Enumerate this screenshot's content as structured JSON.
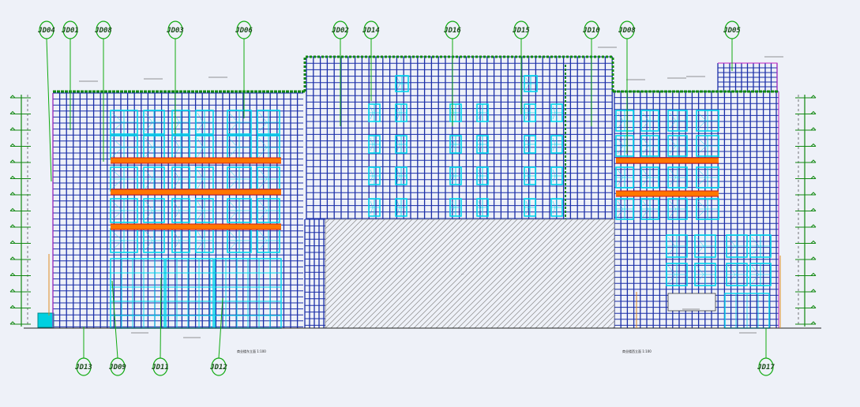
{
  "drawing": {
    "colors": {
      "background": "#eef1f8",
      "grid": "#1a2ea8",
      "window_frame": "#00d8ee",
      "band": "#ff7700",
      "band_edge": "#d01818",
      "parapet": "#118811",
      "tag_circle": "#11aa11",
      "tag_text": "#1a4a1a",
      "outline": "#c020c0",
      "hatch": "#8a8a8a",
      "guide": "#e08a20"
    },
    "top_tags": [
      {
        "id": "tag-jd04",
        "label": "JD04"
      },
      {
        "id": "tag-jd01",
        "label": "JD01"
      },
      {
        "id": "tag-jd08a",
        "label": "JD08"
      },
      {
        "id": "tag-jd03",
        "label": "JD03"
      },
      {
        "id": "tag-jd06",
        "label": "JD06"
      },
      {
        "id": "tag-jd02",
        "label": "JD02"
      },
      {
        "id": "tag-jd14",
        "label": "JD14"
      },
      {
        "id": "tag-jd16",
        "label": "JD16"
      },
      {
        "id": "tag-jd15",
        "label": "JD15"
      },
      {
        "id": "tag-jd10",
        "label": "JD10"
      },
      {
        "id": "tag-jd08b",
        "label": "JD08"
      },
      {
        "id": "tag-jd05",
        "label": "JD05"
      }
    ],
    "bottom_tags": [
      {
        "id": "tag-jd13",
        "label": "JD13"
      },
      {
        "id": "tag-jd09",
        "label": "JD09"
      },
      {
        "id": "tag-jd11",
        "label": "JD11"
      },
      {
        "id": "tag-jd12",
        "label": "JD12"
      },
      {
        "id": "tag-jd17",
        "label": "JD17"
      }
    ],
    "captions": {
      "left": "商业楼东立面  1:100",
      "right": "商业楼西立面  1:100"
    }
  }
}
